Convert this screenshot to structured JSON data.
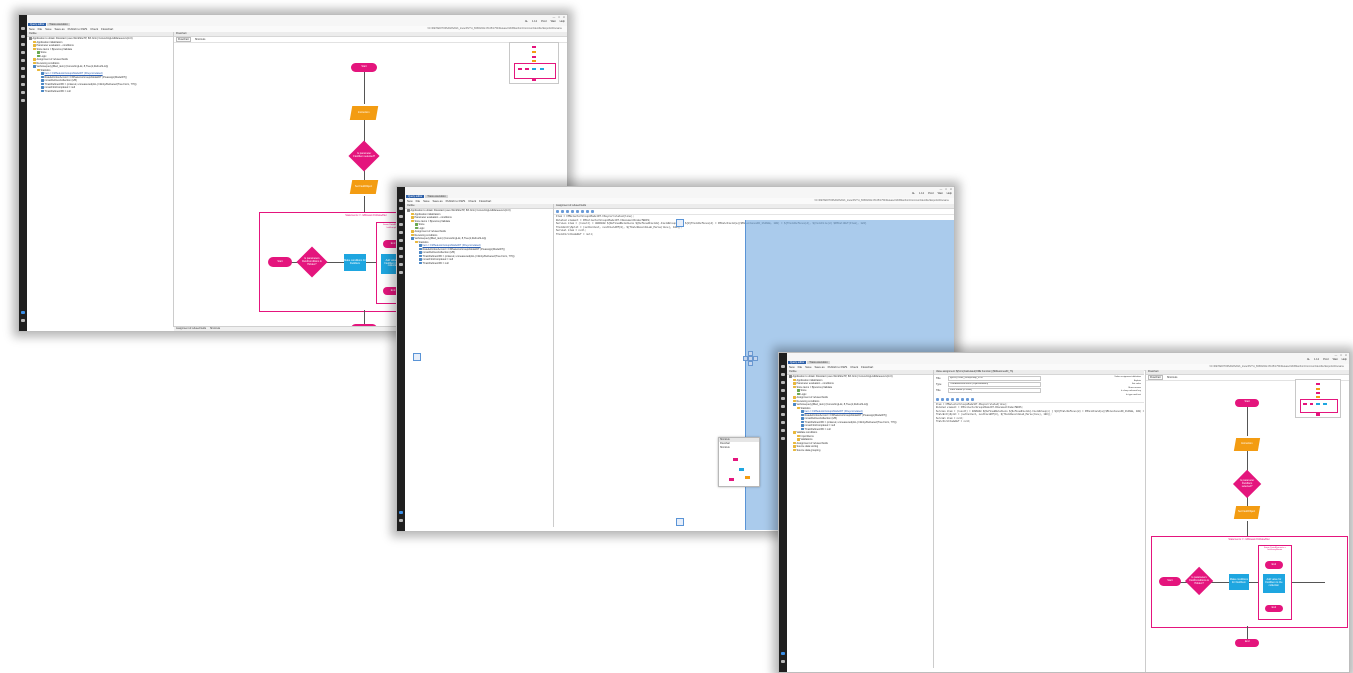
{
  "app": {
    "tabs": [
      "Query editor",
      "Trace execution"
    ],
    "window_controls": [
      "—",
      "□",
      "✕"
    ],
    "account_actions": [
      "AL",
      "1.12",
      "Prod",
      "Wait",
      "Help"
    ],
    "toolbar": [
      "New",
      "File",
      "Save",
      "Save as",
      "Publish to DWS",
      "Check",
      "Flowchart"
    ],
    "path": "\\\\C:\\ZIET\\EDITOR\\2020\\2021_trace\\DVT\\1_6950\\2022-05-05\\1754\\Release\\ShiftManfrom\\Common\\Identifier\\Exports\\Filename"
  },
  "tree": {
    "panel_title": "Outline",
    "items": [
      {
        "text": "Application to obtain Flowstart (uses WorkflowTP, 8th form) ConvertingListManeuvers(ln:0)",
        "indent": 0,
        "icon": "k"
      },
      {
        "text": "Application initialization",
        "indent": 1,
        "icon": "y"
      },
      {
        "text": "Parameter evaluation - conditions",
        "indent": 1,
        "icon": "y"
      },
      {
        "text": "Store items = ${source}.Validate",
        "indent": 1,
        "icon": "y"
      },
      {
        "text": "Store",
        "indent": 2,
        "icon": "g"
      },
      {
        "text": "Logic",
        "indent": 2,
        "icon": "g"
      },
      {
        "text": "Assignment of refused fields",
        "indent": 1,
        "icon": "y"
      },
      {
        "text": "Receiving conditions",
        "indent": 1,
        "icon": "y"
      },
      {
        "text": "Verbosequery(filled_item) (ConvertingList, 8,Tree(1,RefreshList))",
        "indent": 1,
        "icon": "b"
      },
      {
        "text": "Statistics",
        "indent": 2,
        "icon": "y"
      },
      {
        "text": "Item = FMSelectorGroupsModelDT (FKeycorrelated)",
        "indent": 3,
        "icon": "b",
        "link": true
      },
      {
        "text": "RatedefinitionAccord = FMSelectorGroupsModelDT (Preassign(ModelDT))",
        "indent": 3,
        "icon": "b"
      },
      {
        "text": "mmacDefinesCollection (1/B)",
        "indent": 3,
        "icon": "b"
      },
      {
        "text": "TCalcDefinesOfD = (ordered, unmeasured(ALL) Infinity/Delivered(True Form, 776))",
        "indent": 3,
        "icon": "b"
      },
      {
        "text": "mmacFirstCompleted = null",
        "indent": 3,
        "icon": "b"
      },
      {
        "text": "TCalcDefinesOfD = null",
        "indent": 3,
        "icon": "b"
      }
    ],
    "extra_items": [
      {
        "text": "Validate conditions",
        "indent": 1,
        "icon": "y"
      },
      {
        "text": "ImportItems",
        "indent": 2,
        "icon": "y"
      },
      {
        "text": "Validations",
        "indent": 2,
        "icon": "y"
      },
      {
        "text": "Assignment of refused fields",
        "indent": 1,
        "icon": "y"
      },
      {
        "text": "Source data sorting",
        "indent": 1,
        "icon": "y"
      },
      {
        "text": "Source data grouping",
        "indent": 1,
        "icon": "y"
      }
    ]
  },
  "code": {
    "panel_title": "Assignment of refused fields",
    "lines": [
      "Item = FMSelectorGroupsModelDT.FKeycorrelated(line);",
      "Related element = FMCollectorGroupsModelDT.FDocumentIndexfEDFS;",
      "Servios item = (result) = 4096048  ${DefinedRelations  ${DefinedFields}.FieldGroup(n) }    ${0}TCalcDefines(d) = FMCalcField(a)($MilestonesID_1h4b0m, 100) = ${TCalcDefines(d), ${CalcFile(d) $FMCallRef(Item), 122}",
      "TCalcEntrySplit = (setContext, nextFieldOf(0), ${TCalcRecordsLab_Parse(line), 100));",
      "Servial item = null;",
      "TCalcFirstCodeRef = null;"
    ]
  },
  "diagram": {
    "panel_title": "Flowchart",
    "subtabs": [
      "Flowchart",
      "Shortcuts"
    ],
    "bottom_tabs": [
      "Assignment of refused fields",
      "Shortcuts"
    ],
    "loop_label": "Statements => IsBiswamOnDataAfter",
    "nodes": {
      "start": "Start",
      "param1": "Instruction",
      "decision": "Is parameter FieldItem selected?",
      "param2": "Set FieldObject",
      "loop_start": "Start",
      "loop_decision": "Is parameters FieldConditions & Hidden?",
      "process": "Make conditions for FieldItem",
      "inner_label": "Some DataElements = InitGroupName",
      "inner_process": "Add value for FieldItem to the collection",
      "mid_end": "End",
      "end": "End"
    }
  },
  "float_panel": {
    "title": "Shortcuts",
    "tabs": [
      "Flowchart",
      "Shortcuts"
    ]
  },
  "props": {
    "title": "Value assignment: ${form}Calculated(ORE Function) ($MilestonesID_7h)",
    "rows": [
      {
        "label": "Title",
        "value": "${form}TCalc_GroupsSkip_DTB"
      },
      {
        "label": "Type",
        "value": "TRelatedDocuments (ObjectRelation)"
      },
      {
        "label": "Title",
        "value": "Field Status (in order)"
      }
    ],
    "right_labels": [
      "Value assignment definition",
      "Explain",
      "Set value",
      "Show reason",
      "Is sharp relevant key",
      "In type and test"
    ]
  },
  "colors": {
    "terminal": "#e4157d",
    "parallelogram": "#f39c12",
    "process": "#1ea6e0",
    "sidebar": "#1f1f1f",
    "active_tab": "#2c5fa8"
  }
}
